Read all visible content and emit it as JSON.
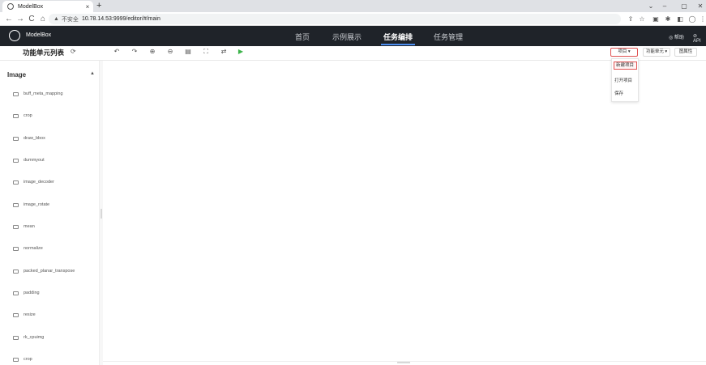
{
  "browser": {
    "tab_title": "ModelBox",
    "tab_close": "×",
    "new_tab": "+",
    "window_controls": [
      "⌄",
      "–",
      "▢",
      "✕"
    ],
    "nav": {
      "back": "←",
      "forward": "→",
      "reload": "C",
      "home": "⌂"
    },
    "address": {
      "warning_icon": "▲",
      "insecure_label": "不安全",
      "url": "10.78.14.53:9999/editor/#/main"
    },
    "bar_icons": [
      "⇪",
      "☆",
      "▣",
      "✱",
      "◧",
      "◯",
      "⋮"
    ]
  },
  "app": {
    "logo_text": "ModelBox",
    "nav_tabs": [
      "首页",
      "示例展示",
      "任务编排",
      "任务管理"
    ],
    "active_tab": "任务编排",
    "header_right": {
      "help": "◎ 帮助",
      "api": "⊘ API"
    }
  },
  "toolbar": {
    "sidebar_title": "功能单元列表",
    "refresh_icon": "⟳",
    "tools": [
      "↶",
      "↷",
      "⊕",
      "⊖",
      "▤",
      "⛶",
      "⇄",
      "▶"
    ],
    "project_btn": "项目 ▾",
    "unit_btn": "功能单元 ▾",
    "graph_btn": "图属性"
  },
  "dropdown": {
    "items": [
      "新建项目",
      "打开项目",
      "保存"
    ]
  },
  "sidebar": {
    "category": "Image",
    "toggle": "▲",
    "units": [
      "buff_meta_mapping",
      "crop",
      "draw_bbox",
      "dummyout",
      "image_decoder",
      "image_rotate",
      "mean",
      "normalize",
      "packed_planar_transpose",
      "padding",
      "resize",
      "rk_cpuimg",
      "crop"
    ]
  },
  "colors": {
    "header_bg": "#1f2329",
    "accent": "#4d8ef0",
    "highlight": "#e05252",
    "run": "#3cb34a"
  }
}
